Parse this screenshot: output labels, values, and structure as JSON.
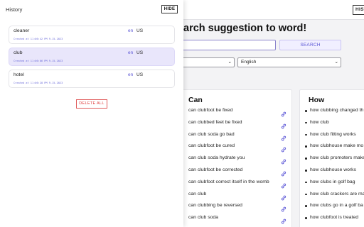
{
  "page": {
    "history_button_label": "HIST",
    "headline": "arch suggestion to word!",
    "search_button_label": "SEARCH",
    "country_select_value": "",
    "language_select_value": "English"
  },
  "cards": [
    {
      "title": "Can",
      "items": [
        "can clubfoot be fixed",
        "can clubbed feet be fixed",
        "can club soda go bad",
        "can clubfoot be cured",
        "can club soda hydrate you",
        "can clubfoot be corrected",
        "can clubfoot correct itself in the womb",
        "can club",
        "can clubbing be reversed",
        "can club soda"
      ]
    },
    {
      "title": "How",
      "items": [
        "how clubbing changed th",
        "how club",
        "how club fitting works",
        "how clubhouse make mo",
        "how club promoters make",
        "how clubhouse works",
        "how clubs in golf bag",
        "how club crackers are ma",
        "how clubs go in a golf ba",
        "how clubfoot is treated"
      ]
    }
  ],
  "history": {
    "title": "History",
    "hide_label": "HIDE",
    "delete_all_label": "DELETE ALL",
    "items": [
      {
        "word": "cleaner",
        "lang": "en",
        "country": "US",
        "created": "Created at 11:06:42 PM 9-15-2023",
        "selected": false
      },
      {
        "word": "club",
        "lang": "en",
        "country": "US",
        "created": "Created at 11:06:06 PM 9-15-2023",
        "selected": true
      },
      {
        "word": "hotel",
        "lang": "en",
        "country": "US",
        "created": "Created at 11:06:28 PM 9-15-2023",
        "selected": false
      }
    ]
  },
  "colors": {
    "accent": "#5a55d6",
    "selected_bg": "#e9e6fb",
    "danger": "#e03b3b"
  },
  "icons": {
    "link": "link-icon",
    "chevron": "chevron-down-icon"
  }
}
